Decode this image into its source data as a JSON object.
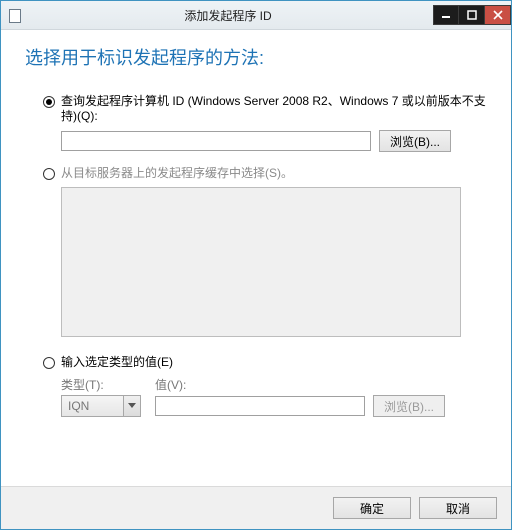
{
  "window": {
    "title": "添加发起程序 ID"
  },
  "heading": "选择用于标识发起程序的方法:",
  "option1": {
    "label": "查询发起程序计算机 ID (Windows Server 2008 R2、Windows 7 或以前版本不支持)(Q):",
    "value": "",
    "browse": "浏览(B)..."
  },
  "option2": {
    "label": "从目标服务器上的发起程序缓存中选择(S)。"
  },
  "option3": {
    "label": "输入选定类型的值(E)",
    "type_label": "类型(T):",
    "type_value": "IQN",
    "value_label": "值(V):",
    "value": "",
    "browse": "浏览(B)..."
  },
  "footer": {
    "ok": "确定",
    "cancel": "取消"
  }
}
